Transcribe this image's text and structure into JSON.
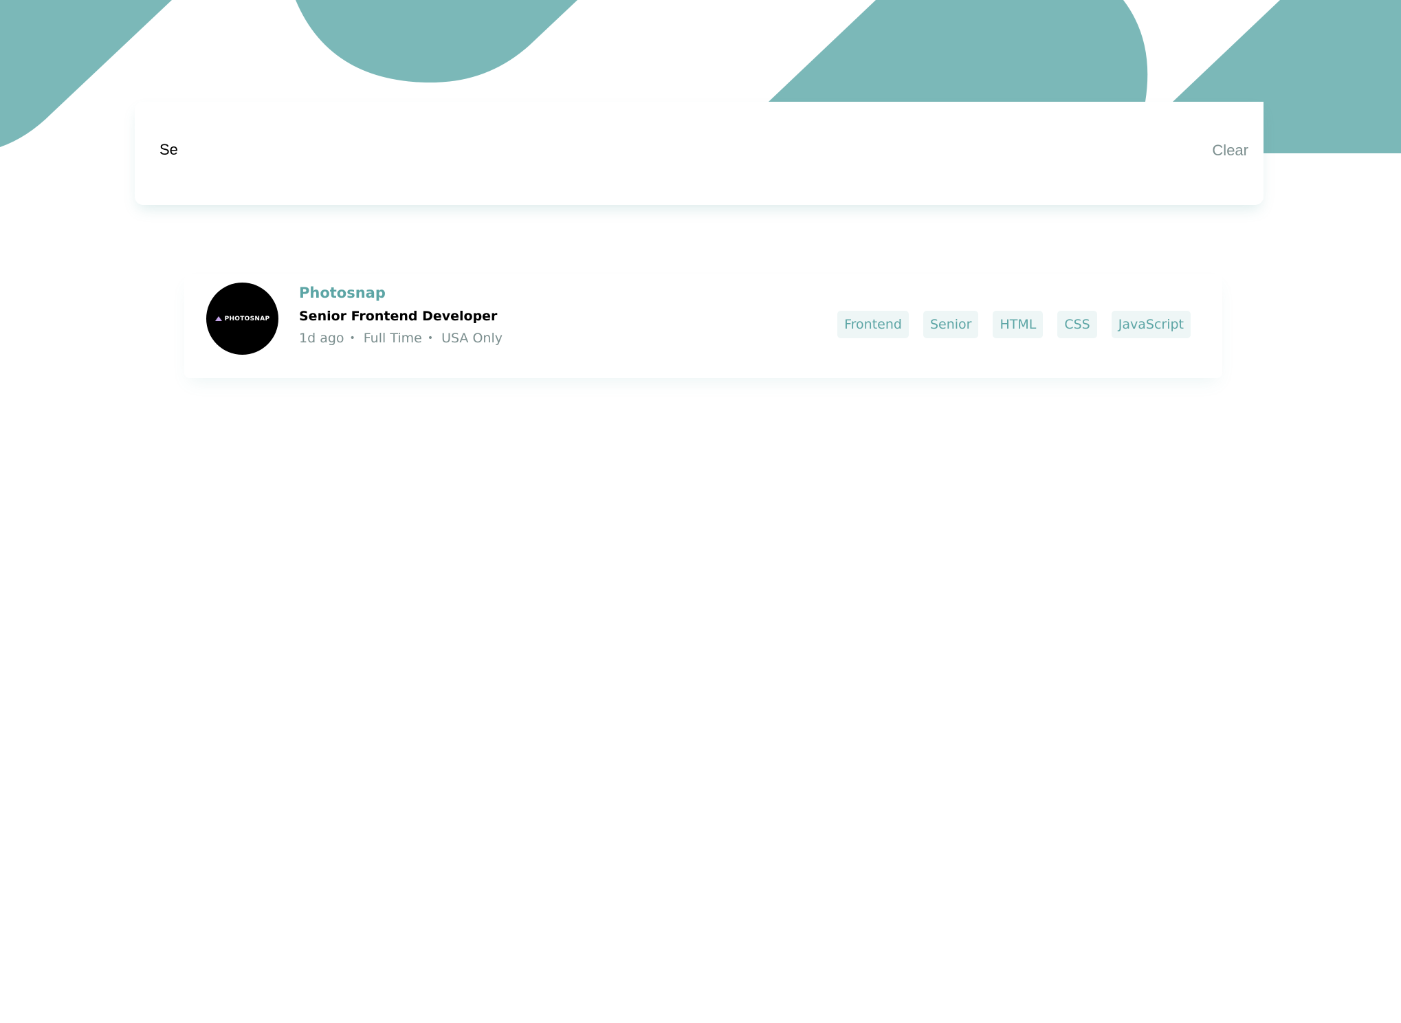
{
  "theme": {
    "accent": "#5ca5a5",
    "header_pattern": "#7bb8b8",
    "tag_bg": "#eef6f6",
    "muted_text": "#7b8e8e"
  },
  "search": {
    "value": "Se",
    "clear_label": "Clear"
  },
  "job": {
    "logo_text": "PHOTOSNAP",
    "company": "Photosnap",
    "position": "Senior Frontend Developer",
    "posted": "1d ago",
    "contract": "Full Time",
    "location": "USA Only",
    "tags": [
      "Frontend",
      "Senior",
      "HTML",
      "CSS",
      "JavaScript"
    ]
  }
}
